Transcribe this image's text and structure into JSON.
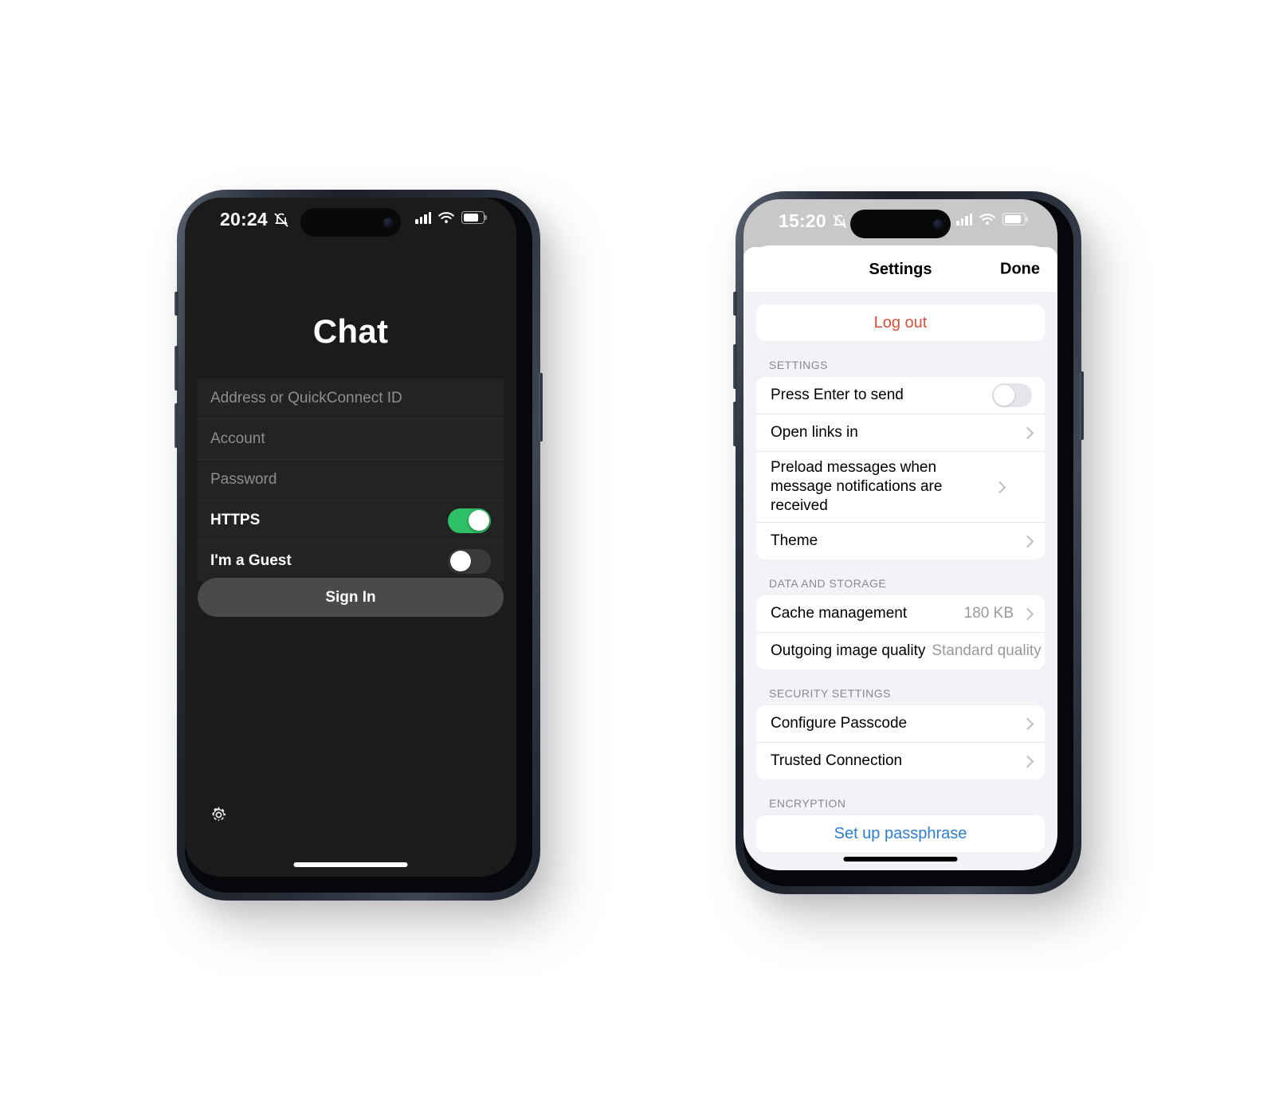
{
  "phone_login": {
    "status_bar": {
      "time": "20:24",
      "silent_icon": "bell-slash-icon",
      "cellular_icon": "cellular-bars-icon",
      "wifi_icon": "wifi-icon",
      "battery_icon": "battery-icon"
    },
    "app_title": "Chat",
    "fields": [
      {
        "name": "address",
        "placeholder": "Address or QuickConnect ID",
        "value": ""
      },
      {
        "name": "account",
        "placeholder": "Account",
        "value": ""
      },
      {
        "name": "password",
        "placeholder": "Password",
        "value": ""
      }
    ],
    "toggles": [
      {
        "name": "https",
        "label": "HTTPS",
        "state": "on"
      },
      {
        "name": "guest",
        "label": "I'm a Guest",
        "state": "off"
      }
    ],
    "sign_in_label": "Sign In",
    "settings_gear_icon": "gear-icon",
    "colors": {
      "toggle_on": "#2fbf66",
      "toggle_off": "#3a3a3a",
      "background": "#1b1b1b",
      "button": "#4a4a4a"
    }
  },
  "phone_settings": {
    "status_bar": {
      "time": "15:20",
      "silent_icon": "bell-slash-icon",
      "cellular_icon": "cellular-bars-icon",
      "wifi_icon": "wifi-icon",
      "battery_icon": "battery-icon"
    },
    "nav": {
      "title": "Settings",
      "done_label": "Done"
    },
    "log_out_label": "Log out",
    "sections": [
      {
        "header": "SETTINGS",
        "rows": [
          {
            "label": "Press Enter to send",
            "accessory": "toggle",
            "state": "off"
          },
          {
            "label": "Open links in",
            "accessory": "chevron"
          },
          {
            "label": "Preload messages when message notifications are received",
            "accessory": "chevron"
          },
          {
            "label": "Theme",
            "accessory": "chevron"
          }
        ]
      },
      {
        "header": "DATA AND STORAGE",
        "rows": [
          {
            "label": "Cache management",
            "value": "180 KB",
            "accessory": "chevron"
          },
          {
            "label": "Outgoing image quality",
            "value": "Standard quality",
            "accessory": "chevron"
          }
        ]
      },
      {
        "header": "SECURITY SETTINGS",
        "rows": [
          {
            "label": "Configure Passcode",
            "accessory": "chevron"
          },
          {
            "label": "Trusted Connection",
            "accessory": "chevron"
          }
        ]
      },
      {
        "header": "ENCRYPTION",
        "action": "Set up passphrase"
      }
    ],
    "colors": {
      "log_out": "#d9503f",
      "link": "#2d7dd2",
      "background": "#f2f2f7",
      "toggle_off": "#e6e6ea"
    }
  }
}
